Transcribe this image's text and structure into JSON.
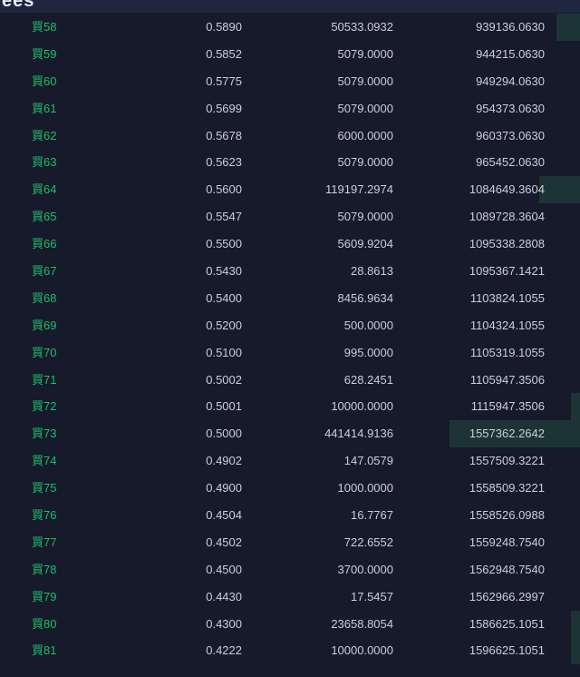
{
  "header": {
    "title_fragment": "ees"
  },
  "colors": {
    "background": "#161a2a",
    "buy_label": "#1fbf6b",
    "text": "#c9cfdc",
    "depth_bar": "#1d3436"
  },
  "rows": [
    {
      "label": "買58",
      "price": "0.5890",
      "amount": "50533.0932",
      "total": "939136.0630",
      "depth": 0.04
    },
    {
      "label": "買59",
      "price": "0.5852",
      "amount": "5079.0000",
      "total": "944215.0630",
      "depth": 0.0
    },
    {
      "label": "買60",
      "price": "0.5775",
      "amount": "5079.0000",
      "total": "949294.0630",
      "depth": 0.0
    },
    {
      "label": "買61",
      "price": "0.5699",
      "amount": "5079.0000",
      "total": "954373.0630",
      "depth": 0.0
    },
    {
      "label": "買62",
      "price": "0.5678",
      "amount": "6000.0000",
      "total": "960373.0630",
      "depth": 0.0
    },
    {
      "label": "買63",
      "price": "0.5623",
      "amount": "5079.0000",
      "total": "965452.0630",
      "depth": 0.0
    },
    {
      "label": "買64",
      "price": "0.5600",
      "amount": "119197.2974",
      "total": "1084649.3604",
      "depth": 0.07
    },
    {
      "label": "買65",
      "price": "0.5547",
      "amount": "5079.0000",
      "total": "1089728.3604",
      "depth": 0.0
    },
    {
      "label": "買66",
      "price": "0.5500",
      "amount": "5609.9204",
      "total": "1095338.2808",
      "depth": 0.0
    },
    {
      "label": "買67",
      "price": "0.5430",
      "amount": "28.8613",
      "total": "1095367.1421",
      "depth": 0.0
    },
    {
      "label": "買68",
      "price": "0.5400",
      "amount": "8456.9634",
      "total": "1103824.1055",
      "depth": 0.0
    },
    {
      "label": "買69",
      "price": "0.5200",
      "amount": "500.0000",
      "total": "1104324.1055",
      "depth": 0.0
    },
    {
      "label": "買70",
      "price": "0.5100",
      "amount": "995.0000",
      "total": "1105319.1055",
      "depth": 0.0
    },
    {
      "label": "買71",
      "price": "0.5002",
      "amount": "628.2451",
      "total": "1105947.3506",
      "depth": 0.0
    },
    {
      "label": "買72",
      "price": "0.5001",
      "amount": "10000.0000",
      "total": "1115947.3506",
      "depth": 0.015
    },
    {
      "label": "買73",
      "price": "0.5000",
      "amount": "441414.9136",
      "total": "1557362.2642",
      "depth": 0.225
    },
    {
      "label": "買74",
      "price": "0.4902",
      "amount": "147.0579",
      "total": "1557509.3221",
      "depth": 0.0
    },
    {
      "label": "買75",
      "price": "0.4900",
      "amount": "1000.0000",
      "total": "1558509.3221",
      "depth": 0.0
    },
    {
      "label": "買76",
      "price": "0.4504",
      "amount": "16.7767",
      "total": "1558526.0988",
      "depth": 0.0
    },
    {
      "label": "買77",
      "price": "0.4502",
      "amount": "722.6552",
      "total": "1559248.7540",
      "depth": 0.0
    },
    {
      "label": "買78",
      "price": "0.4500",
      "amount": "3700.0000",
      "total": "1562948.7540",
      "depth": 0.0
    },
    {
      "label": "買79",
      "price": "0.4430",
      "amount": "17.5457",
      "total": "1562966.2997",
      "depth": 0.0
    },
    {
      "label": "買80",
      "price": "0.4300",
      "amount": "23658.8054",
      "total": "1586625.1051",
      "depth": 0.015
    },
    {
      "label": "買81",
      "price": "0.4222",
      "amount": "10000.0000",
      "total": "1596625.1051",
      "depth": 0.015
    }
  ]
}
